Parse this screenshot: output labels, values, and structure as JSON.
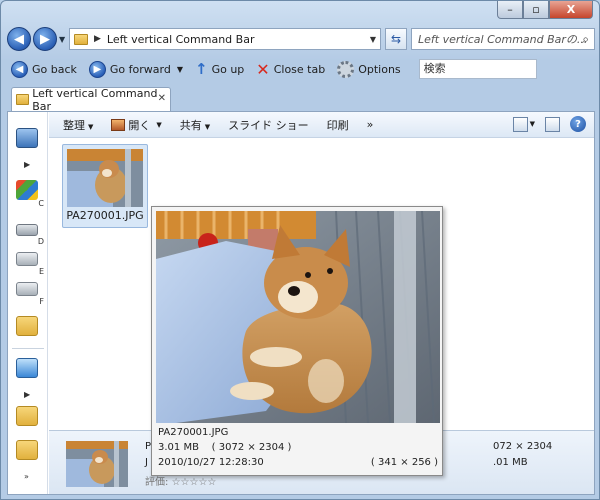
{
  "window": {
    "caption_buttons": [
      "–",
      "▫",
      "X"
    ]
  },
  "address": {
    "path": "Left vertical Command Bar",
    "search_placeholder": "Left vertical Command Barの..."
  },
  "commands": {
    "go_back": "Go back",
    "go_forward": "Go forward",
    "go_up": "Go up",
    "close_tab": "Close tab",
    "options": "Options",
    "search_value": "検索"
  },
  "tabs": [
    {
      "label": "Left vertical Command Bar"
    }
  ],
  "left_strip": {
    "labels": [
      "C",
      "D",
      "E",
      "F"
    ]
  },
  "toolbar": {
    "organize": "整理",
    "open": "開く",
    "share": "共有",
    "slideshow": "スライド ショー",
    "print": "印刷",
    "more": "»"
  },
  "file": {
    "name": "PA270001.JPG"
  },
  "popup": {
    "filename": "PA270001.JPG",
    "size": "3.01 MB",
    "dimensions": "( 3072 × 2304 )",
    "date": "2010/10/27 12:28:30",
    "display_dims": "( 341 × 256 )"
  },
  "details": {
    "label_fragment": "P",
    "date_fragment": "J",
    "rating_label": "評価:",
    "dims_fragment": "072 × 2304",
    "size_fragment": ".01 MB"
  },
  "colors": {
    "accent": "#2a60b8",
    "close_red": "#c6452c"
  }
}
